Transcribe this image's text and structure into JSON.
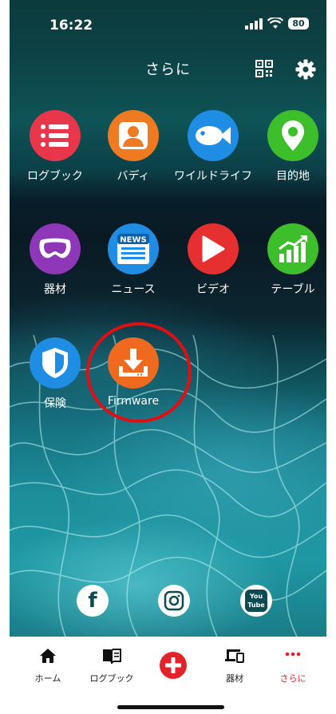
{
  "status": {
    "time": "16:22",
    "battery": "80"
  },
  "header": {
    "title": "さらに"
  },
  "apps": [
    {
      "label": "ログブック",
      "icon": "list-icon",
      "color": "#e8374a"
    },
    {
      "label": "バディ",
      "icon": "buddy-icon",
      "color": "#ee7a22"
    },
    {
      "label": "ワイルドライフ",
      "icon": "fish-icon",
      "color": "#1f8de3"
    },
    {
      "label": "目的地",
      "icon": "location-pin-icon",
      "color": "#3dbf2c"
    },
    {
      "label": "器材",
      "icon": "mask-icon",
      "color": "#8e38b7"
    },
    {
      "label": "ニュース",
      "icon": "news-icon",
      "color": "#1f8de3",
      "badge": "NEWS"
    },
    {
      "label": "ビデオ",
      "icon": "play-icon",
      "color": "#e63030"
    },
    {
      "label": "テーブル",
      "icon": "chart-icon",
      "color": "#3dbf2c"
    },
    {
      "label": "保険",
      "icon": "shield-icon",
      "color": "#1f8de3"
    },
    {
      "label": "Firmware",
      "icon": "download-icon",
      "color": "#ef6a1e"
    }
  ],
  "social": [
    {
      "icon": "facebook-icon",
      "glyph": "f"
    },
    {
      "icon": "instagram-icon"
    },
    {
      "icon": "youtube-icon",
      "line1": "You",
      "line2": "Tube"
    }
  ],
  "tabbar": {
    "home": "ホーム",
    "logbook": "ログブック",
    "gear": "器材",
    "more": "さらに",
    "active_color": "#e32229"
  }
}
